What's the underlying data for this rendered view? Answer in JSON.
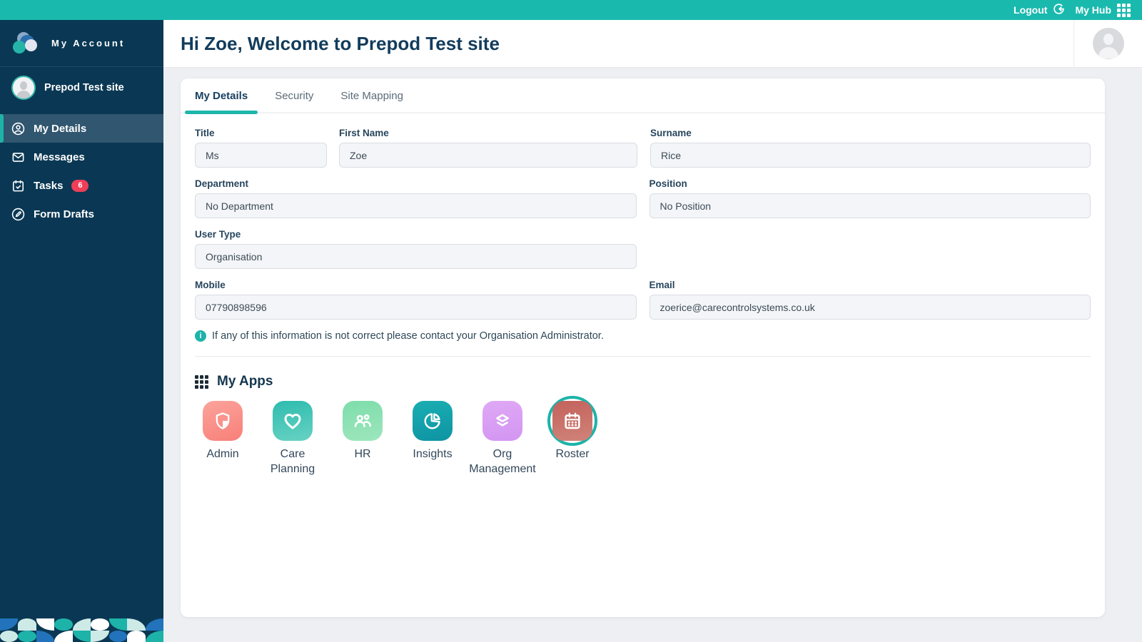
{
  "topbar": {
    "logout_label": "Logout",
    "my_hub_label": "My Hub"
  },
  "sidebar": {
    "brand": "My Account",
    "site_name": "Prepod Test site",
    "items": [
      {
        "label": "My Details",
        "icon": "person-circle-icon",
        "active": true
      },
      {
        "label": "Messages",
        "icon": "envelope-icon"
      },
      {
        "label": "Tasks",
        "icon": "calendar-check-icon",
        "badge": "6"
      },
      {
        "label": "Form Drafts",
        "icon": "pencil-circle-icon"
      }
    ]
  },
  "header": {
    "title": "Hi Zoe, Welcome to Prepod Test site"
  },
  "tabs": [
    {
      "label": "My Details",
      "active": true
    },
    {
      "label": "Security"
    },
    {
      "label": "Site Mapping"
    }
  ],
  "form": {
    "fields": [
      {
        "label": "Title",
        "value": "Ms"
      },
      {
        "label": "First Name",
        "value": "Zoe"
      },
      {
        "label": "Surname",
        "value": "Rice"
      },
      {
        "label": "Department",
        "value": "No Department"
      },
      {
        "label": "Position",
        "value": "No Position"
      },
      {
        "label": "User Type",
        "value": "Organisation"
      },
      {
        "label": "Mobile",
        "value": "07790898596"
      },
      {
        "label": "Email",
        "value": "zoerice@carecontrolsystems.co.uk"
      }
    ],
    "note": "If any of this information is not correct please contact your Organisation Administrator."
  },
  "my_apps": {
    "title": "My Apps",
    "apps": [
      {
        "label": "Admin",
        "icon": "shield-icon",
        "color": "#f87f78"
      },
      {
        "label": "Care Planning",
        "icon": "heart-icon",
        "color": "#2ebcae"
      },
      {
        "label": "HR",
        "icon": "people-icon",
        "color": "#7eddaa"
      },
      {
        "label": "Insights",
        "icon": "pie-chart-icon",
        "color": "#0e94a3"
      },
      {
        "label": "Org Management",
        "icon": "layers-icon",
        "color": "#d395f1"
      },
      {
        "label": "Roster",
        "icon": "calendar-icon",
        "color": "#c3625c",
        "selected": true
      }
    ]
  },
  "colors": {
    "accent_teal": "#1ab9ae",
    "sidebar_navy": "#0a3854",
    "badge_red": "#ef3e58",
    "title_navy": "#123c5c"
  }
}
